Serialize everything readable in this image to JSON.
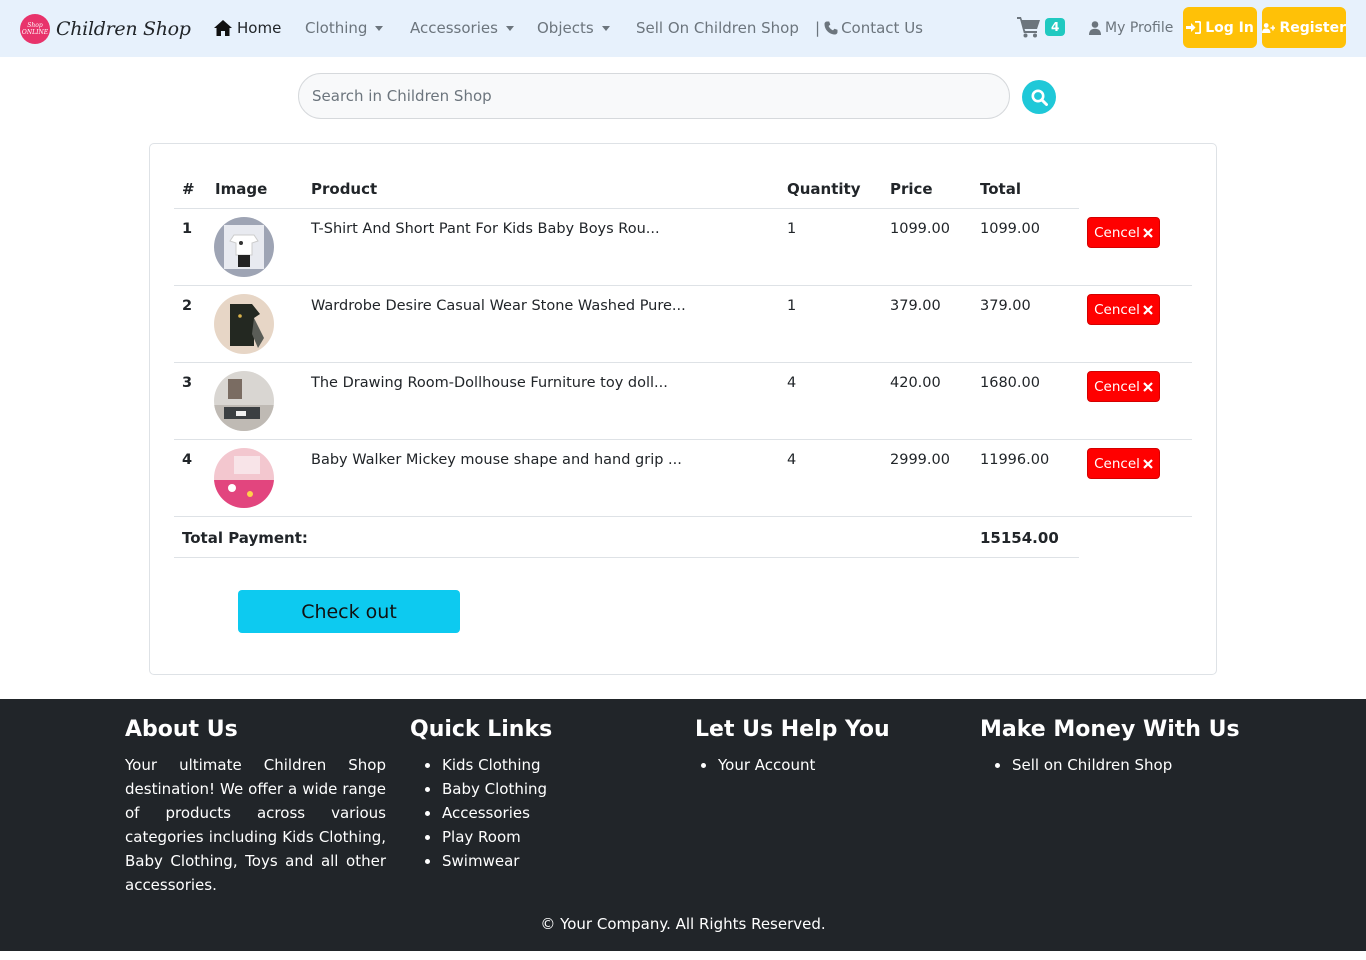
{
  "brand": {
    "logo_text": "Shop ONLINE",
    "name": "Children Shop"
  },
  "nav": {
    "home": "Home",
    "clothing": "Clothing",
    "accessories": "Accessories",
    "objects": "Objects",
    "sell": "Sell On Children Shop",
    "contact_prefix": "|",
    "contact": "Contact Us",
    "cart_count": "4",
    "profile": "My Profile",
    "login": "Log In",
    "register": "Register"
  },
  "search": {
    "placeholder": "Search in Children Shop"
  },
  "cart_table": {
    "headers": {
      "num": "#",
      "image": "Image",
      "product": "Product",
      "quantity": "Quantity",
      "price": "Price",
      "total": "Total"
    },
    "rows": [
      {
        "num": "1",
        "product": "T-Shirt And Short Pant For Kids Baby Boys Rou...",
        "quantity": "1",
        "price": "1099.00",
        "total": "1099.00",
        "action": "Cencel"
      },
      {
        "num": "2",
        "product": "Wardrobe Desire Casual Wear Stone Washed Pure...",
        "quantity": "1",
        "price": "379.00",
        "total": "379.00",
        "action": "Cencel"
      },
      {
        "num": "3",
        "product": "The Drawing Room-Dollhouse Furniture toy doll...",
        "quantity": "4",
        "price": "420.00",
        "total": "1680.00",
        "action": "Cencel"
      },
      {
        "num": "4",
        "product": "Baby Walker Mickey mouse shape and hand grip ...",
        "quantity": "4",
        "price": "2999.00",
        "total": "11996.00",
        "action": "Cencel"
      }
    ],
    "total_label": "Total Payment:",
    "total_value": "15154.00",
    "checkout": "Check out"
  },
  "footer": {
    "about_title": "About Us",
    "about_text": "Your ultimate Children Shop destination! We offer a wide range of products across various categories including Kids Clothing, Baby Clothing, Toys and all other accessories.",
    "quick_title": "Quick Links",
    "quick_links": [
      "Kids Clothing",
      "Baby Clothing",
      "Accessories",
      "Play Room",
      "Swimwear"
    ],
    "help_title": "Let Us Help You",
    "help_links": [
      "Your Account"
    ],
    "money_title": "Make Money With Us",
    "money_links": [
      "Sell on Children Shop"
    ],
    "copyright": "© Your Company. All Rights Reserved."
  },
  "colors": {
    "navbar_bg": "#e7f1fc",
    "accent_yellow": "#ffc107",
    "cart_badge": "#20c9c0",
    "search_button": "#1fc8d8",
    "cancel_red": "#ff0000",
    "checkout_cyan": "#0dcaf0",
    "footer_bg": "#212529"
  },
  "icons": {
    "home": "home-icon",
    "cart": "cart-icon",
    "user": "user-icon",
    "phone": "phone-icon",
    "login": "login-icon",
    "register": "user-plus-icon",
    "search": "search-icon",
    "cancel": "close-icon"
  }
}
